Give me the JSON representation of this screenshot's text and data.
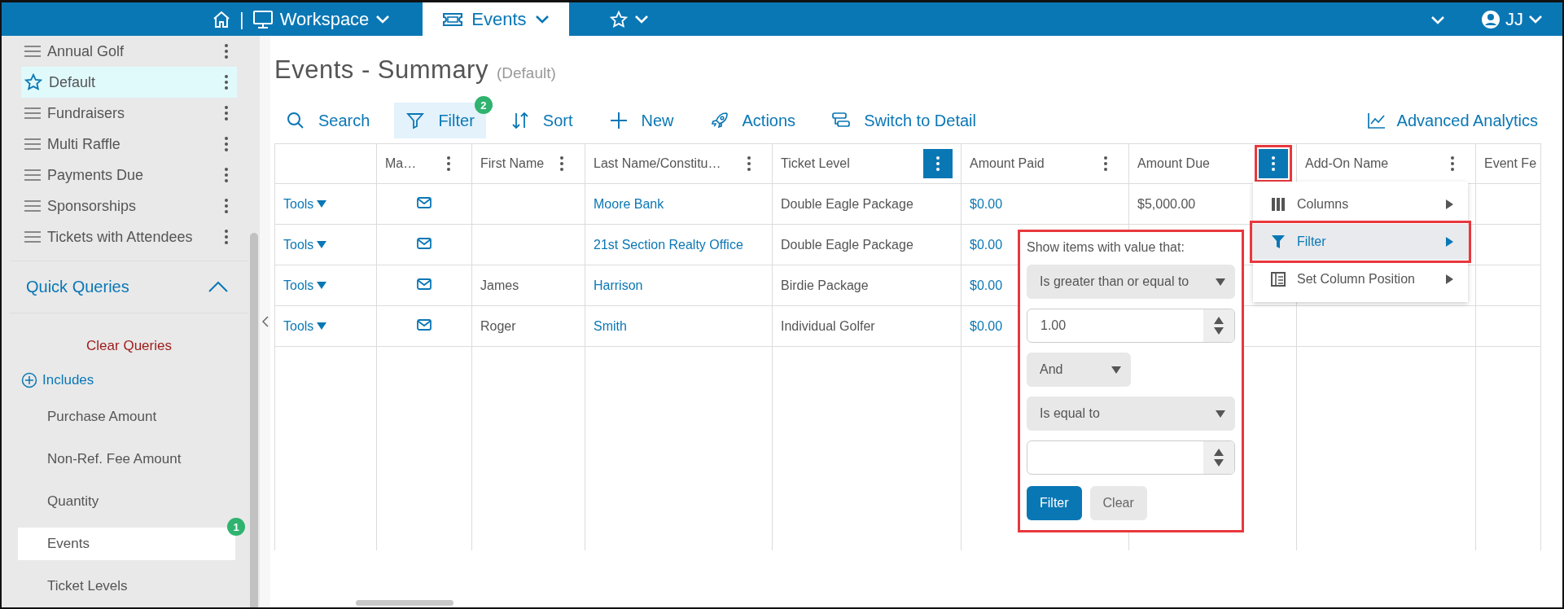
{
  "top_bar": {
    "separator": "|",
    "workspace": "Workspace",
    "tabs": [
      {
        "label": "Events",
        "selected": true
      }
    ],
    "user": "JJ"
  },
  "sidebar": {
    "views": [
      {
        "label": "Annual Golf",
        "kind": "view",
        "selected": false
      },
      {
        "label": "Default",
        "kind": "favorite",
        "selected": true
      },
      {
        "label": "Fundraisers",
        "kind": "view",
        "selected": false
      },
      {
        "label": "Multi Raffle",
        "kind": "view",
        "selected": false
      },
      {
        "label": "Payments Due",
        "kind": "view",
        "selected": false
      },
      {
        "label": "Sponsorships",
        "kind": "view",
        "selected": false
      },
      {
        "label": "Tickets with Attendees",
        "kind": "view",
        "selected": false
      }
    ],
    "quick_queries": {
      "title": "Quick Queries",
      "expanded": true,
      "clear": "Clear Queries",
      "includes": "Includes",
      "items": [
        {
          "label": "Purchase Amount",
          "selected": false
        },
        {
          "label": "Non-Ref. Fee Amount",
          "selected": false
        },
        {
          "label": "Quantity",
          "selected": false
        },
        {
          "label": "Events",
          "selected": true,
          "badge": "1"
        },
        {
          "label": "Ticket Levels",
          "selected": false
        }
      ]
    }
  },
  "page": {
    "title": "Events - Summary",
    "view": "(Default)"
  },
  "toolbar": [
    {
      "label": "Search",
      "kind": "search",
      "selected": false
    },
    {
      "label": "Filter",
      "kind": "filter",
      "selected": true,
      "badge": "2"
    },
    {
      "label": "Sort",
      "kind": "sort",
      "selected": false
    },
    {
      "label": "New",
      "kind": "new",
      "selected": false
    },
    {
      "label": "Actions",
      "kind": "actions",
      "selected": false
    },
    {
      "label": "Switch to Detail",
      "kind": "switch",
      "selected": false
    }
  ],
  "analytics": "Advanced Analytics",
  "table": {
    "columns": [
      {
        "kind": "tools"
      },
      {
        "label": "Ma…",
        "kind": "icon",
        "menu_button": {
          "active": false,
          "highlighted": false
        }
      },
      {
        "label": "First Name",
        "kind": "text",
        "menu_button": {
          "active": false,
          "highlighted": false
        }
      },
      {
        "label": "Last Name/Constitu…",
        "kind": "link",
        "menu_button": {
          "active": false,
          "highlighted": false
        }
      },
      {
        "label": "Ticket Level",
        "kind": "text",
        "menu_button": {
          "active": true,
          "highlighted": false
        }
      },
      {
        "label": "Amount Paid",
        "kind": "link",
        "menu_button": {
          "active": false,
          "highlighted": false
        }
      },
      {
        "label": "Amount Due",
        "kind": "text",
        "menu_button": {
          "active": true,
          "highlighted": true
        }
      },
      {
        "label": "Add-On Name",
        "kind": "text",
        "menu_button": {
          "active": false,
          "highlighted": false
        }
      },
      {
        "label": "Event Fe",
        "kind": "text"
      }
    ],
    "rows": [
      {
        "cells": [
          "Tools",
          "",
          "",
          "Moore Bank",
          "Double Eagle Package",
          "$0.00",
          "$5,000.00",
          "",
          ""
        ]
      },
      {
        "cells": [
          "Tools",
          "",
          "",
          "21st Section Realty Office",
          "Double Eagle Package",
          "$0.00",
          "",
          "",
          ""
        ]
      },
      {
        "cells": [
          "Tools",
          "",
          "James",
          "Harrison",
          "Birdie Package",
          "$0.00",
          "",
          "",
          ""
        ]
      },
      {
        "cells": [
          "Tools",
          "",
          "Roger",
          "Smith",
          "Individual Golfer",
          "$0.00",
          "",
          "",
          ""
        ]
      }
    ]
  },
  "column_menu": {
    "items": [
      {
        "label": "Columns",
        "kind": "columns",
        "selected": false,
        "highlighted": false
      },
      {
        "label": "Filter",
        "kind": "filter",
        "selected": true,
        "highlighted": true
      },
      {
        "label": "Set Column Position",
        "kind": "position",
        "selected": false,
        "highlighted": false
      }
    ]
  },
  "filter_popup": {
    "highlighted": true,
    "prompt": "Show items with value that:",
    "operator_1": "Is greater than or equal to",
    "value_1": "1.00",
    "logic": "And",
    "operator_2": "Is equal to",
    "buttons": [
      {
        "label": "Filter",
        "kind": "primary"
      },
      {
        "label": "Clear",
        "kind": "secondary"
      }
    ]
  }
}
